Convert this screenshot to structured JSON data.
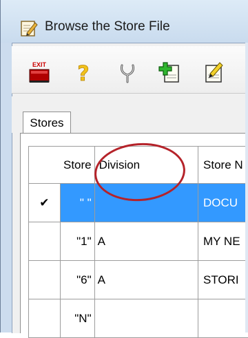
{
  "window": {
    "title": "Browse the Store File"
  },
  "toolbar": {
    "buttons": [
      {
        "name": "exit-button",
        "label": "EXIT",
        "icon": "exit-icon"
      },
      {
        "name": "help-button",
        "label": "",
        "icon": "question-mark-icon"
      },
      {
        "name": "fork-button",
        "label": "",
        "icon": "wishbone-icon"
      },
      {
        "name": "add-button",
        "label": "",
        "icon": "add-record-icon"
      },
      {
        "name": "edit-button",
        "label": "",
        "icon": "edit-record-icon"
      }
    ]
  },
  "tabs": [
    {
      "label": "Stores",
      "active": true
    }
  ],
  "grid": {
    "columns": [
      "",
      "Store",
      "Division",
      "Store N"
    ],
    "rows": [
      {
        "selected": true,
        "checked": true,
        "store": "\" \"",
        "division": "",
        "name": "DOCU"
      },
      {
        "selected": false,
        "checked": false,
        "store": "\"1\"",
        "division": "A",
        "name": "MY NE"
      },
      {
        "selected": false,
        "checked": false,
        "store": "\"6\"",
        "division": "A",
        "name": "STORI"
      },
      {
        "selected": false,
        "checked": false,
        "store": "\"N\"",
        "division": "",
        "name": ""
      }
    ]
  },
  "annotation": {
    "highlight_color": "#b5232a"
  }
}
